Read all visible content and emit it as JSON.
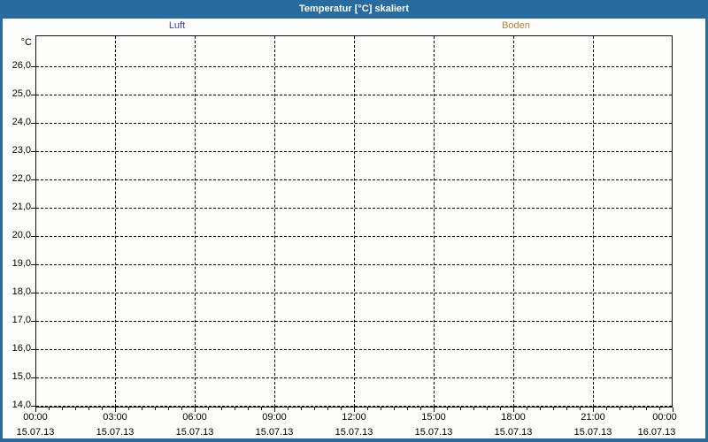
{
  "window": {
    "title": "Temperatur [°C] skaliert"
  },
  "colors": {
    "titlebar": "#286b9e",
    "window_border": "#286b9e",
    "content_background": "#fdfefc",
    "axis_and_grid": "#000000",
    "luft": "#3c3ccc",
    "boden": "#b5823f"
  },
  "chart_data": {
    "type": "line",
    "title": "Temperatur [°C] skaliert",
    "xlabel": "",
    "ylabel": "°C",
    "ylim": [
      14.0,
      27.1
    ],
    "grid": "dashed",
    "legend_position": "top",
    "series": [
      {
        "name": "Luft",
        "color": "#3c3ccc",
        "values": []
      },
      {
        "name": "Boden",
        "color": "#b5823f",
        "values": []
      }
    ],
    "y_ticks": [
      {
        "label": "26,0",
        "value": 26.0
      },
      {
        "label": "25,0",
        "value": 25.0
      },
      {
        "label": "24,0",
        "value": 24.0
      },
      {
        "label": "23,0",
        "value": 23.0
      },
      {
        "label": "22,0",
        "value": 22.0
      },
      {
        "label": "21,0",
        "value": 21.0
      },
      {
        "label": "20,0",
        "value": 20.0
      },
      {
        "label": "19,0",
        "value": 19.0
      },
      {
        "label": "18,0",
        "value": 18.0
      },
      {
        "label": "17,0",
        "value": 17.0
      },
      {
        "label": "16,0",
        "value": 16.0
      },
      {
        "label": "15,0",
        "value": 15.0
      },
      {
        "label": "14,0",
        "value": 14.0
      }
    ],
    "x_axis": {
      "major_ticks": [
        {
          "time": "00:00",
          "date": "15.07.13"
        },
        {
          "time": "03:00",
          "date": "15.07.13"
        },
        {
          "time": "06:00",
          "date": "15.07.13"
        },
        {
          "time": "09:00",
          "date": "15.07.13"
        },
        {
          "time": "12:00",
          "date": "15.07.13"
        },
        {
          "time": "15:00",
          "date": "15.07.13"
        },
        {
          "time": "18:00",
          "date": "15.07.13"
        },
        {
          "time": "21:00",
          "date": "15.07.13"
        },
        {
          "time": "00:00",
          "date": "16.07.13"
        }
      ],
      "minor_tick_interval_minutes": 30
    }
  }
}
